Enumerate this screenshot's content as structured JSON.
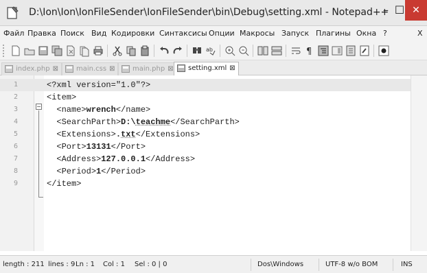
{
  "window": {
    "title": "D:\\Ion\\Ion\\IonFileSender\\IonFileSender\\bin\\Debug\\setting.xml - Notepad++",
    "minimize": "–",
    "maximize": "☐",
    "close": "✕"
  },
  "menu": [
    "Файл",
    "Правка",
    "Поиск",
    "Вид",
    "Кодировки",
    "Синтаксисы",
    "Опции",
    "Макросы",
    "Запуск",
    "Плагины",
    "Окна",
    "?",
    "X"
  ],
  "tabs": [
    {
      "label": "index.php",
      "close": "⊠",
      "active": false
    },
    {
      "label": "main.css",
      "close": "⊠",
      "active": false
    },
    {
      "label": "main.php",
      "close": "⊠",
      "active": false
    },
    {
      "label": "setting.xml",
      "close": "⊠",
      "active": true
    }
  ],
  "editor": {
    "line_numbers": [
      "1",
      "2",
      "3",
      "4",
      "5",
      "6",
      "7",
      "8",
      "9"
    ],
    "current_line": 1,
    "lines": [
      {
        "indent": "",
        "parts": [
          {
            "t": "<?xml version=\"1.0\"?>"
          }
        ]
      },
      {
        "indent": "",
        "parts": [
          {
            "t": "<item>"
          }
        ]
      },
      {
        "indent": "  ",
        "parts": [
          {
            "t": "<name>"
          },
          {
            "t": "wrench",
            "b": true
          },
          {
            "t": "</name>"
          }
        ]
      },
      {
        "indent": "  ",
        "parts": [
          {
            "t": "<SearchParth>"
          },
          {
            "t": "D:\\",
            "b": true
          },
          {
            "t": "teachme",
            "b": true,
            "u": true
          },
          {
            "t": "</SearchParth>"
          }
        ]
      },
      {
        "indent": "  ",
        "parts": [
          {
            "t": "<Extensions>"
          },
          {
            "t": ".",
            "b": true
          },
          {
            "t": "txt",
            "b": true,
            "u": true
          },
          {
            "t": "</Extensions>"
          }
        ]
      },
      {
        "indent": "  ",
        "parts": [
          {
            "t": "<Port>"
          },
          {
            "t": "13131",
            "b": true
          },
          {
            "t": "</Port>"
          }
        ]
      },
      {
        "indent": "  ",
        "parts": [
          {
            "t": "<Address>"
          },
          {
            "t": "127.0.0.1",
            "b": true
          },
          {
            "t": "</Address>"
          }
        ]
      },
      {
        "indent": "  ",
        "parts": [
          {
            "t": "<Period>"
          },
          {
            "t": "1",
            "b": true
          },
          {
            "t": "</Period>"
          }
        ]
      },
      {
        "indent": "",
        "parts": [
          {
            "t": "</item>"
          }
        ]
      }
    ]
  },
  "status": {
    "length": "length : 211",
    "lines": "lines : 9",
    "ln": "Ln : 1",
    "col": "Col : 1",
    "sel": "Sel : 0 | 0",
    "eol": "Dos\\Windows",
    "encoding": "UTF-8 w/o BOM",
    "mode": "INS"
  }
}
